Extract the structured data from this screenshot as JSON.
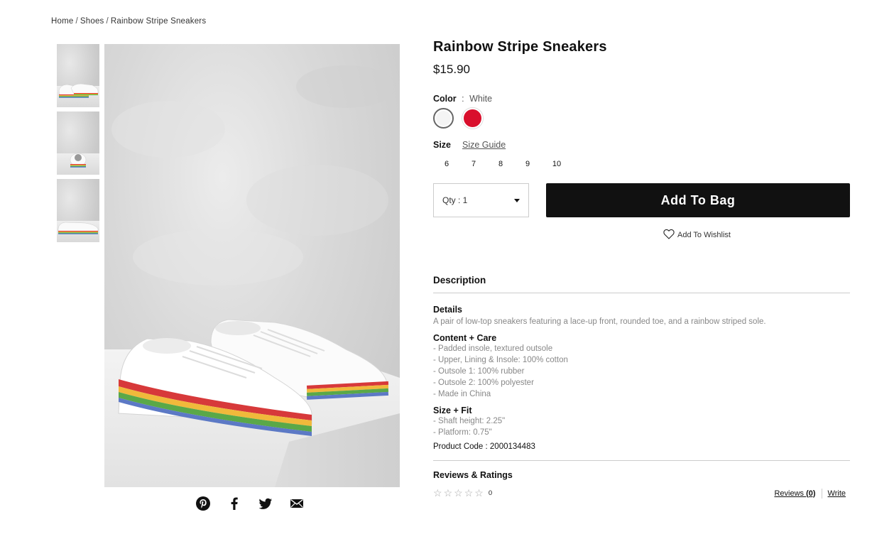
{
  "breadcrumb": {
    "items": [
      "Home",
      "Shoes",
      "Rainbow Stripe Sneakers"
    ],
    "separator": "/"
  },
  "product": {
    "title": "Rainbow Stripe Sneakers",
    "price": "$15.90",
    "color_label": "Color",
    "color_sep": ":",
    "color_value": "White",
    "swatches": [
      {
        "name": "White",
        "hex": "#f4f4f4"
      },
      {
        "name": "Red",
        "hex": "#d90f2c"
      }
    ],
    "size_label": "Size",
    "size_guide": "Size Guide",
    "sizes": [
      "6",
      "7",
      "8",
      "9",
      "10"
    ],
    "qty_text": "Qty : 1",
    "add_to_bag": "Add To Bag",
    "wishlist": "Add To Wishlist"
  },
  "description": {
    "heading": "Description",
    "details_heading": "Details",
    "details_text": "A pair of low-top sneakers featuring a lace-up front, rounded toe, and a rainbow striped sole.",
    "care_heading": "Content + Care",
    "care_items": [
      "- Padded insole, textured outsole",
      "- Upper, Lining & Insole: 100% cotton",
      "- Outsole 1: 100% rubber",
      "- Outsole 2: 100% polyester",
      "- Made in China"
    ],
    "fit_heading": "Size + Fit",
    "fit_items": [
      "- Shaft height: 2.25\"",
      "- Platform: 0.75\""
    ],
    "product_code": "Product Code : 2000134483"
  },
  "reviews": {
    "heading": "Reviews & Ratings",
    "rating": 0,
    "max_rating": 5,
    "count": "0",
    "reviews_link": "Reviews (0)",
    "write_link": "Write"
  },
  "share_icons": [
    "pinterest-icon",
    "facebook-icon",
    "twitter-icon",
    "email-icon"
  ],
  "colors": {
    "button_bg": "#111111",
    "swatch_red": "#d90f2c",
    "muted_text": "#888888"
  }
}
